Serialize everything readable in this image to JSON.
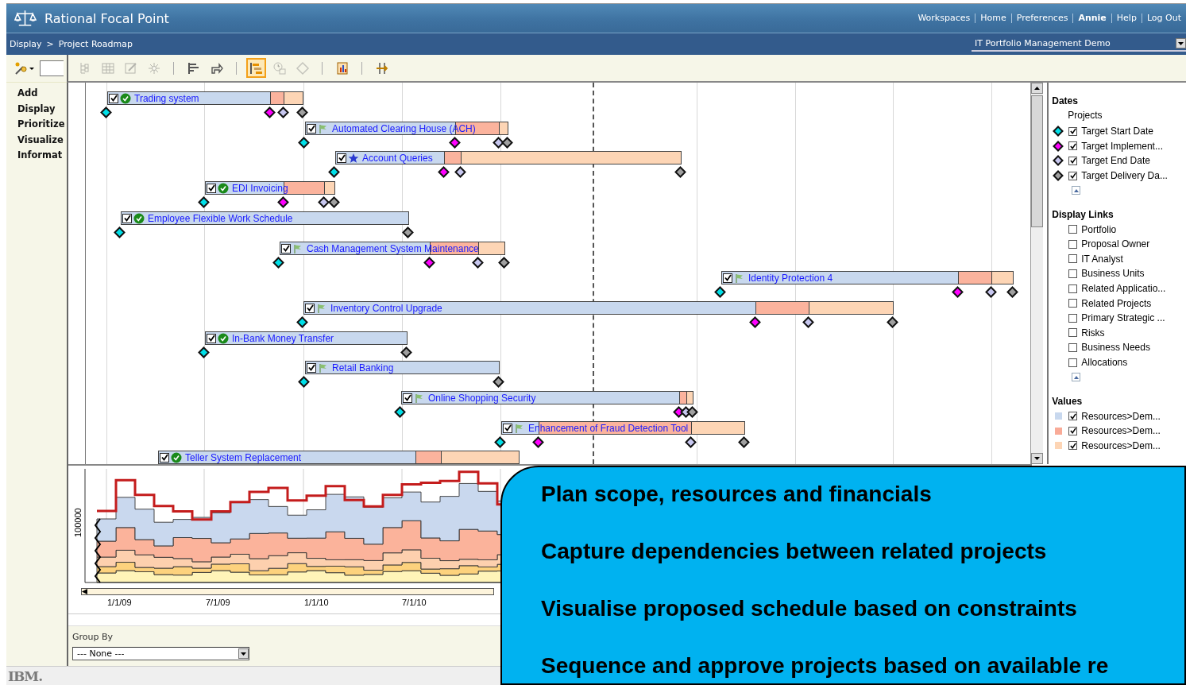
{
  "header": {
    "title": "Rational Focal Point",
    "links": [
      {
        "label": "Workspaces",
        "kind": "link"
      },
      {
        "label": "Home",
        "kind": "link"
      },
      {
        "label": "Preferences",
        "kind": "link"
      },
      {
        "label": "Annie",
        "kind": "user"
      },
      {
        "label": "Help",
        "kind": "link"
      },
      {
        "label": "Log Out",
        "kind": "link"
      }
    ]
  },
  "breadcrumb": {
    "items": [
      "Display",
      "Project Roadmap"
    ],
    "separator": ">"
  },
  "workspace_select": {
    "value": "IT Portfolio Management Demo"
  },
  "sidebar": {
    "items": [
      "Add",
      "Display",
      "Prioritize",
      "Visualize",
      "Informat"
    ]
  },
  "toolbar": {
    "groups": [
      [
        {
          "selected": false,
          "disabled": true
        },
        {
          "selected": false,
          "disabled": true
        },
        {
          "selected": false,
          "disabled": true
        },
        {
          "selected": false,
          "disabled": true
        }
      ],
      [
        {
          "selected": false,
          "disabled": false
        },
        {
          "selected": false,
          "disabled": false
        }
      ],
      [
        {
          "selected": true,
          "disabled": false
        },
        {
          "selected": false,
          "disabled": true
        },
        {
          "selected": false,
          "disabled": true
        }
      ],
      [
        {
          "selected": false,
          "disabled": false
        }
      ],
      [
        {
          "selected": false,
          "disabled": false
        }
      ]
    ]
  },
  "projects": [
    {
      "name": "Trading system",
      "checked": true,
      "kind": "complete",
      "milestones": [
        {
          "kind": "start"
        },
        {
          "kind": "implement"
        },
        {
          "kind": "end"
        },
        {
          "kind": "delivery"
        }
      ]
    },
    {
      "name": "Automated Clearing House (ACH)",
      "checked": true,
      "kind": "flagged",
      "milestones": [
        {
          "kind": "start"
        },
        {
          "kind": "implement"
        },
        {
          "kind": "end"
        },
        {
          "kind": "delivery"
        }
      ]
    },
    {
      "name": "Account Queries",
      "checked": true,
      "kind": "starred",
      "milestones": [
        {
          "kind": "start"
        },
        {
          "kind": "implement"
        },
        {
          "kind": "end"
        },
        {
          "kind": "delivery"
        }
      ]
    },
    {
      "name": "EDI Invoicing",
      "checked": true,
      "kind": "complete",
      "milestones": [
        {
          "kind": "start"
        },
        {
          "kind": "implement"
        },
        {
          "kind": "end"
        },
        {
          "kind": "delivery"
        }
      ]
    },
    {
      "name": "Employee Flexible Work Schedule",
      "checked": true,
      "kind": "complete",
      "milestones": [
        {
          "kind": "start"
        },
        {
          "kind": "delivery"
        }
      ]
    },
    {
      "name": "Cash Management System Maintenance",
      "checked": true,
      "kind": "flagged",
      "milestones": [
        {
          "kind": "start"
        },
        {
          "kind": "implement"
        },
        {
          "kind": "end"
        },
        {
          "kind": "delivery"
        }
      ]
    },
    {
      "name": "Identity Protection 4",
      "checked": true,
      "kind": "flagged",
      "milestones": [
        {
          "kind": "start"
        },
        {
          "kind": "implement"
        },
        {
          "kind": "end"
        },
        {
          "kind": "delivery"
        }
      ]
    },
    {
      "name": "Inventory Control Upgrade",
      "checked": true,
      "kind": "flagged",
      "milestones": [
        {
          "kind": "start"
        },
        {
          "kind": "implement"
        },
        {
          "kind": "end"
        },
        {
          "kind": "delivery"
        }
      ]
    },
    {
      "name": "In-Bank Money Transfer",
      "checked": true,
      "kind": "complete",
      "milestones": [
        {
          "kind": "start"
        },
        {
          "kind": "delivery"
        }
      ]
    },
    {
      "name": "Retail Banking",
      "checked": true,
      "kind": "flagged",
      "milestones": [
        {
          "kind": "start"
        },
        {
          "kind": "delivery"
        }
      ]
    },
    {
      "name": "Online Shopping Security",
      "checked": true,
      "kind": "flagged",
      "milestones": [
        {
          "kind": "start"
        },
        {
          "kind": "implement"
        },
        {
          "kind": "end"
        },
        {
          "kind": "delivery"
        }
      ]
    },
    {
      "name": "Enhancement of Fraud Detection Tool",
      "checked": true,
      "kind": "flagged",
      "milestones": [
        {
          "kind": "start"
        },
        {
          "kind": "implement"
        },
        {
          "kind": "end"
        },
        {
          "kind": "delivery"
        }
      ]
    },
    {
      "name": "Teller System Replacement",
      "checked": true,
      "kind": "complete"
    }
  ],
  "legend": {
    "dates": {
      "title": "Dates",
      "subtitle": "Projects",
      "items": [
        {
          "label": "Target Start Date",
          "kind": "start",
          "color": "#00e0e8",
          "checked": true
        },
        {
          "label": "Target Implement...",
          "kind": "implement",
          "color": "#ff00ff",
          "checked": true
        },
        {
          "label": "Target End Date",
          "kind": "end",
          "color": "#c8c8f0",
          "checked": true
        },
        {
          "label": "Target Delivery Da...",
          "kind": "delivery",
          "color": "#a0a0a0",
          "checked": true
        }
      ]
    },
    "links": {
      "title": "Display Links",
      "items": [
        {
          "label": "Portfolio",
          "checked": false
        },
        {
          "label": "Proposal Owner",
          "checked": false
        },
        {
          "label": "IT Analyst",
          "checked": false
        },
        {
          "label": "Business Units",
          "checked": false
        },
        {
          "label": "Related Applicatio...",
          "checked": false
        },
        {
          "label": "Related Projects",
          "checked": false
        },
        {
          "label": "Primary Strategic ...",
          "checked": false
        },
        {
          "label": "Risks",
          "checked": false
        },
        {
          "label": "Business Needs",
          "checked": false
        },
        {
          "label": "Allocations",
          "checked": false
        }
      ]
    },
    "values": {
      "title": "Values",
      "items": [
        {
          "label": "Resources>Dem...",
          "color": "#c8d8ee",
          "checked": true
        },
        {
          "label": "Resources>Dem...",
          "color": "#f9ab98",
          "checked": true
        },
        {
          "label": "Resources>Dem...",
          "color": "#fdd5b5",
          "checked": true
        }
      ]
    }
  },
  "chart": {
    "y_label": "100000",
    "x_labels": [
      "1/1/09",
      "7/1/09",
      "1/1/10",
      "7/1/10"
    ]
  },
  "group_by": {
    "label": "Group By",
    "value": "--- None ---"
  },
  "callout": {
    "lines": [
      "Plan scope, resources and financials",
      "Capture dependencies between related projects",
      "Visualise proposed schedule based on constraints",
      "Sequence and approve projects based on available re"
    ]
  },
  "footer": {
    "logo": "IBM."
  }
}
